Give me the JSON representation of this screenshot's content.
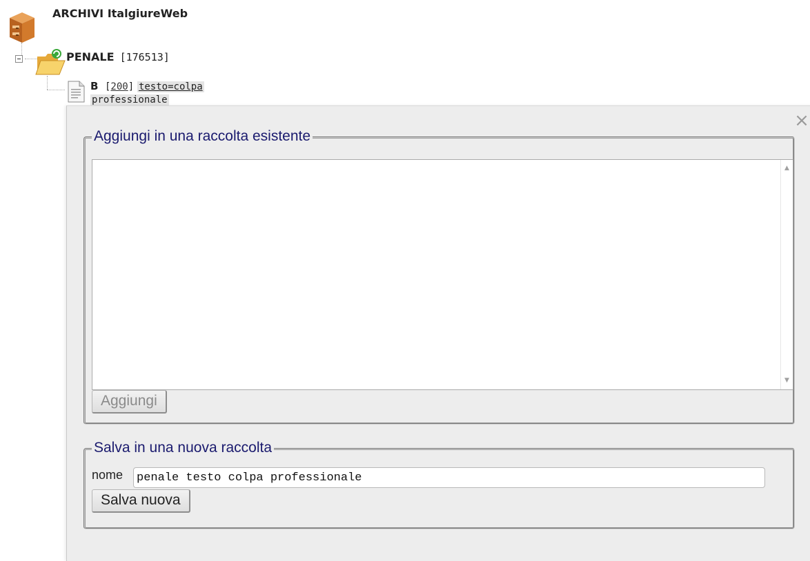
{
  "tree": {
    "root_label": "ARCHIVI ItalgiureWeb",
    "archive": {
      "name": "PENALE",
      "count": "[176513]"
    },
    "search": {
      "letter": "B",
      "count_open": "[",
      "count": "200",
      "count_close": "]",
      "query_line1": "testo=colpa",
      "query_line2": "professionale"
    }
  },
  "dialog": {
    "close_symbol": "×",
    "existing_section": {
      "legend": "Aggiungi in una raccolta esistente",
      "add_button": "Aggiungi"
    },
    "new_section": {
      "legend": "Salva in una nuova raccolta",
      "name_label": "nome",
      "name_value": "penale testo colpa professionale",
      "save_button": "Salva nuova"
    }
  },
  "colors": {
    "legend": "#1a1a6e",
    "dialog_bg": "#ededed"
  },
  "icons": [
    "archive-cabinet-icon",
    "expand-collapse-icon",
    "open-folder-icon",
    "document-icon",
    "close-icon",
    "scroll-up-arrow-icon",
    "scroll-down-arrow-icon"
  ]
}
